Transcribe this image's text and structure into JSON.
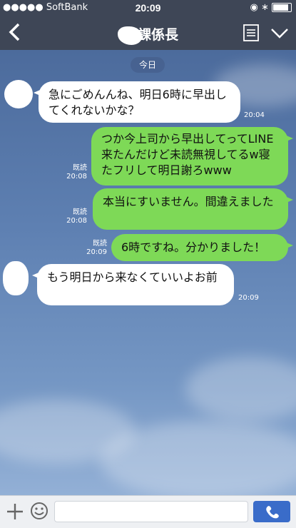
{
  "status_bar": {
    "carrier": "●●●●● SoftBank",
    "time": "20:09",
    "right_icons": "◉ ∗"
  },
  "header": {
    "title": "課係長"
  },
  "chat": {
    "date_label": "今日",
    "messages": [
      {
        "side": "in",
        "text": "急にごめんんね、明日6時に早出してくれないかな？",
        "time": "20:04"
      },
      {
        "side": "out",
        "text": "つか今上司から早出してってLINE来たんだけど未読無視してるw寝たフリして明日謝ろwww",
        "read": "既読",
        "time": "20:08"
      },
      {
        "side": "out",
        "text": "本当にすいません。間違えました",
        "read": "既読",
        "time": "20:08"
      },
      {
        "side": "out",
        "text": "6時ですね。分かりました！",
        "read": "既読",
        "time": "20:09"
      },
      {
        "side": "in",
        "text": "もう明日から来なくていいよお前",
        "time": "20:09"
      }
    ]
  },
  "colors": {
    "header_bg": "#3e4656",
    "out_bubble": "#7ed957",
    "in_bubble": "#ffffff",
    "call_button": "#3a6cc9"
  },
  "icons": [
    "back-chevron-icon",
    "menu-list-icon",
    "chevron-down-icon",
    "plus-icon",
    "smile-icon",
    "phone-icon"
  ]
}
